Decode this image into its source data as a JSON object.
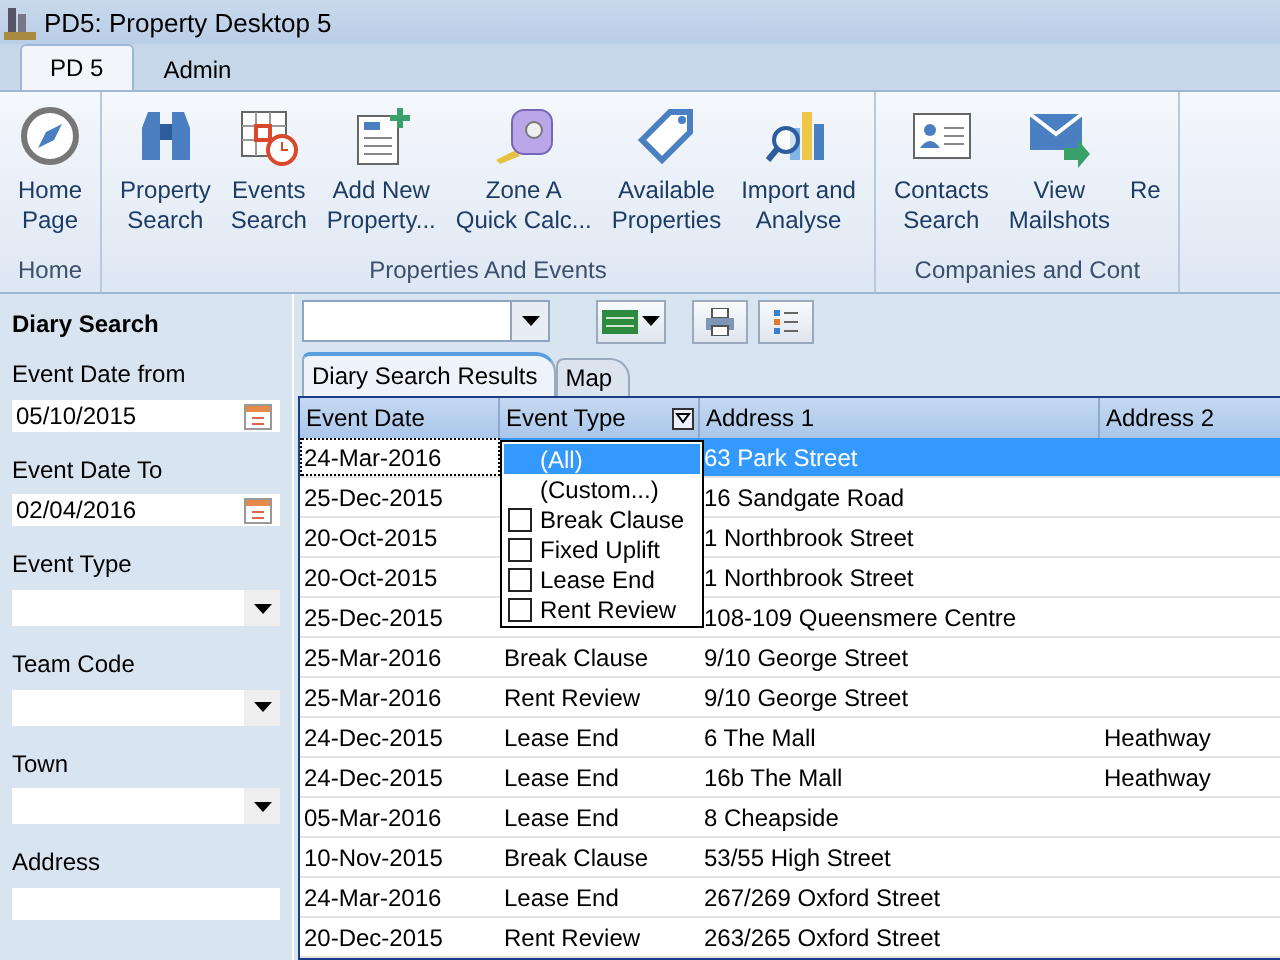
{
  "window": {
    "title": "PD5: Property Desktop 5"
  },
  "ribbon_tabs": [
    {
      "label": "PD 5",
      "selected": true
    },
    {
      "label": "Admin",
      "selected": false
    }
  ],
  "ribbon_groups": [
    {
      "label": "Home",
      "buttons": [
        {
          "lines": [
            "Home",
            "Page"
          ]
        }
      ]
    },
    {
      "label": "Properties And Events",
      "buttons": [
        {
          "lines": [
            "Property",
            "Search"
          ]
        },
        {
          "lines": [
            "Events",
            "Search"
          ]
        },
        {
          "lines": [
            "Add New",
            "Property..."
          ]
        },
        {
          "lines": [
            "Zone A",
            "Quick Calc..."
          ]
        },
        {
          "lines": [
            "Available",
            "Properties"
          ]
        },
        {
          "lines": [
            "Import and",
            "Analyse"
          ]
        }
      ]
    },
    {
      "label": "Companies and Cont",
      "buttons": [
        {
          "lines": [
            "Contacts",
            "Search"
          ]
        },
        {
          "lines": [
            "View",
            "Mailshots"
          ]
        },
        {
          "lines": [
            "Re"
          ]
        }
      ]
    }
  ],
  "sidebar": {
    "title": "Diary Search",
    "fields": [
      {
        "kind": "date",
        "label": "Event Date from",
        "value": "05/10/2015"
      },
      {
        "kind": "date",
        "label": "Event Date To",
        "value": "02/04/2016"
      },
      {
        "kind": "select",
        "label": "Event Type"
      },
      {
        "kind": "select",
        "label": "Team Code"
      },
      {
        "kind": "select",
        "label": "Town"
      },
      {
        "kind": "text",
        "label": "Address"
      }
    ]
  },
  "result_tabs": [
    {
      "label": "Diary Search Results",
      "selected": true
    },
    {
      "label": "Map",
      "selected": false
    }
  ],
  "table": {
    "columns": [
      {
        "label": "Event Date",
        "filter": false
      },
      {
        "label": "Event Type",
        "filter": true
      },
      {
        "label": "Address 1",
        "filter": false
      },
      {
        "label": "Address 2",
        "filter": false
      }
    ],
    "rows": [
      {
        "selected": true,
        "cells": [
          "24-Mar-2016",
          "",
          "63 Park Street",
          ""
        ]
      },
      {
        "selected": false,
        "cells": [
          "25-Dec-2015",
          "",
          "16 Sandgate Road",
          ""
        ]
      },
      {
        "selected": false,
        "cells": [
          "20-Oct-2015",
          "",
          "1 Northbrook Street",
          ""
        ]
      },
      {
        "selected": false,
        "cells": [
          "20-Oct-2015",
          "",
          "1 Northbrook Street",
          ""
        ]
      },
      {
        "selected": false,
        "cells": [
          "25-Dec-2015",
          "",
          "108-109 Queensmere Centre",
          ""
        ]
      },
      {
        "selected": false,
        "cells": [
          "25-Mar-2016",
          "Break Clause",
          "9/10 George Street",
          ""
        ]
      },
      {
        "selected": false,
        "cells": [
          "25-Mar-2016",
          "Rent Review",
          "9/10 George Street",
          ""
        ]
      },
      {
        "selected": false,
        "cells": [
          "24-Dec-2015",
          "Lease End",
          "6 The Mall",
          "Heathway"
        ]
      },
      {
        "selected": false,
        "cells": [
          "24-Dec-2015",
          "Lease End",
          "16b The Mall",
          "Heathway"
        ]
      },
      {
        "selected": false,
        "cells": [
          "05-Mar-2016",
          "Lease End",
          "8 Cheapside",
          ""
        ]
      },
      {
        "selected": false,
        "cells": [
          "10-Nov-2015",
          "Break Clause",
          "53/55 High Street",
          ""
        ]
      },
      {
        "selected": false,
        "cells": [
          "24-Mar-2016",
          "Lease End",
          "267/269 Oxford Street",
          ""
        ]
      },
      {
        "selected": false,
        "cells": [
          "20-Dec-2015",
          "Rent Review",
          "263/265 Oxford Street",
          ""
        ]
      }
    ]
  },
  "filter_menu": {
    "items": [
      {
        "kind": "option",
        "label": "(All)",
        "selected": true
      },
      {
        "kind": "option",
        "label": "(Custom...)",
        "selected": false
      },
      {
        "kind": "check",
        "label": "Break Clause",
        "checked": false
      },
      {
        "kind": "check",
        "label": "Fixed Uplift",
        "checked": false
      },
      {
        "kind": "check",
        "label": "Lease End",
        "checked": false
      },
      {
        "kind": "check",
        "label": "Rent Review",
        "checked": false
      }
    ]
  }
}
